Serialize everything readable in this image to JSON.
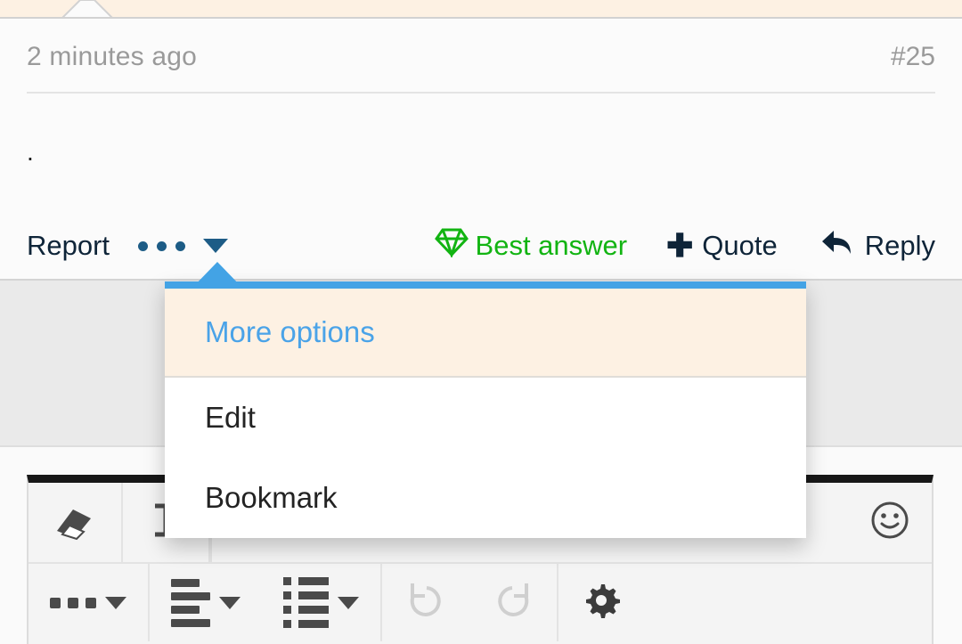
{
  "banner": {
    "color": "#fdf1e3",
    "notch_icon": "triangle-notch-icon"
  },
  "post": {
    "date": "2 minutes ago",
    "number": "#25",
    "body": "."
  },
  "actions": [
    {
      "key": "report",
      "label": "Report",
      "icon": null,
      "color": "#0e2438"
    },
    {
      "key": "more",
      "label": "",
      "icon": "ellipsis-icon",
      "color": "#1d5c86"
    },
    {
      "key": "best_answer",
      "label": "Best answer",
      "icon": "diamond-icon",
      "color": "#12b412"
    },
    {
      "key": "quote",
      "label": "Quote",
      "icon": "plus-icon",
      "color": "#0e2438"
    },
    {
      "key": "reply",
      "label": "Reply",
      "icon": "reply-arrow-icon",
      "color": "#0e2438"
    }
  ],
  "dropdown": {
    "accent_color": "#43a3e5",
    "header_background": "#fdf1e3",
    "items": [
      {
        "label": "More options",
        "highlighted": true
      },
      {
        "label": "Edit",
        "highlighted": false
      },
      {
        "label": "Bookmark",
        "highlighted": false
      }
    ]
  },
  "editor_toolbar": {
    "row1": [
      {
        "name": "eraser-button",
        "icon": "eraser-icon",
        "disabled": false
      },
      {
        "name": "paste-text-button",
        "icon": "paste-text-icon",
        "disabled": false
      },
      {
        "name": "emoji-button",
        "icon": "smiley-icon",
        "disabled": false
      }
    ],
    "row2": [
      {
        "name": "more-formats-button",
        "icon": "ellipsis-icon",
        "caret": true,
        "disabled": false
      },
      {
        "name": "align-button",
        "icon": "align-left-icon",
        "caret": true,
        "disabled": false
      },
      {
        "name": "list-button",
        "icon": "bullet-list-icon",
        "caret": true,
        "disabled": false
      },
      {
        "name": "undo-button",
        "icon": "undo-icon",
        "caret": false,
        "disabled": true
      },
      {
        "name": "redo-button",
        "icon": "redo-icon",
        "caret": false,
        "disabled": true
      },
      {
        "name": "settings-button",
        "icon": "gear-icon",
        "caret": false,
        "disabled": false
      }
    ]
  }
}
